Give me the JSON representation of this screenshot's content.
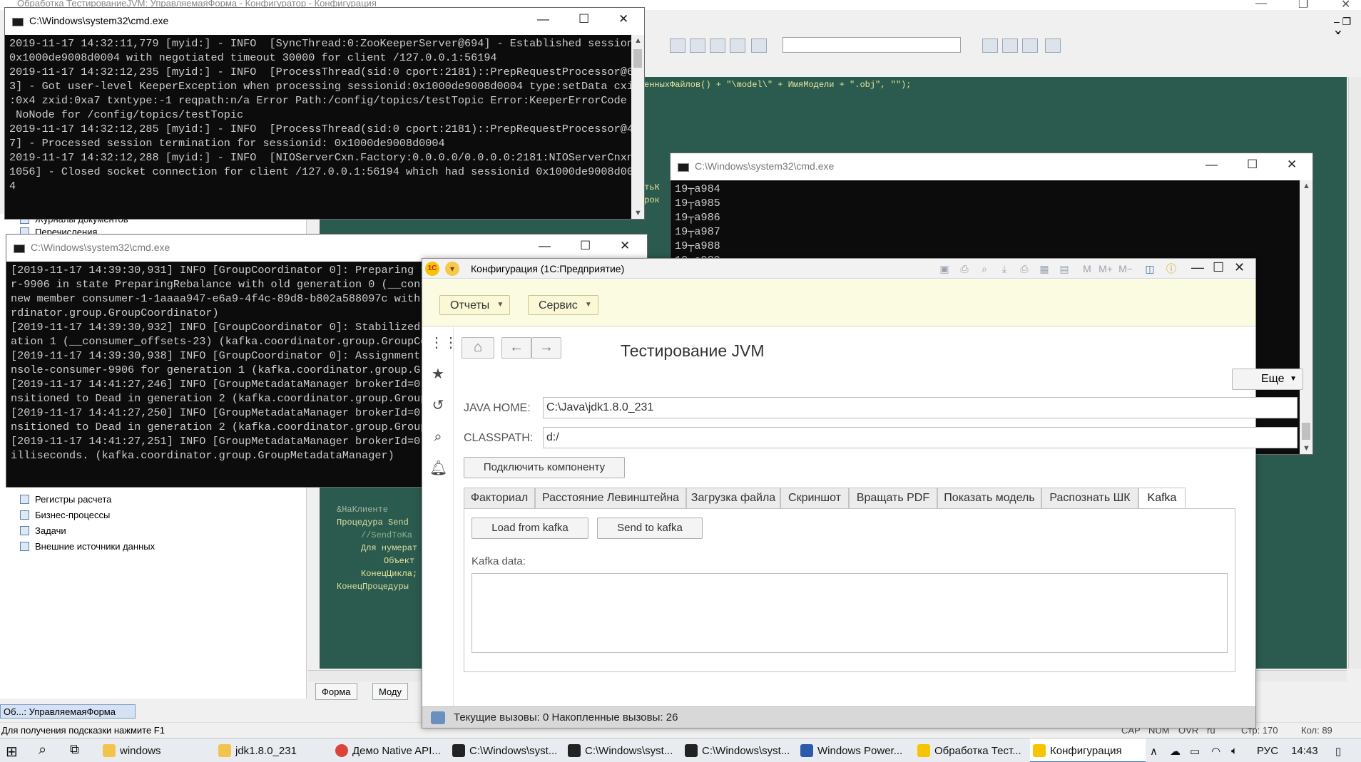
{
  "bg_window": {
    "title": "Обработка ТестированиеJVM: УправляемаяФорма - Конфигуратор - Конфигурация",
    "code_lines": [
      "енныхФайлов() + \"\\model\\\" + ИмяМодели + \".obj\", \"\");",
      "утьК",
      "трок",
      "&НаКлиенте",
      "Процедура Send",
      "//SendToKa",
      "Для нумерат",
      "Объект",
      "КонецЦикла;",
      "КонецПроцедуры"
    ],
    "tree_items": [
      "Журналы документов",
      "Перечисления",
      "Регистры расчета",
      "Бизнес-процессы",
      "Задачи",
      "Внешние источники данных"
    ],
    "bottom_tabs": [
      "Форма",
      "Моду"
    ],
    "window_list_item": "Об...: УправляемаяФорма",
    "status_hint": "Для получения подсказки нажмите F1",
    "status_right": [
      "CAP",
      "NUM",
      "OVR",
      "ru",
      "Стр: 170",
      "Кол: 89"
    ]
  },
  "cmd1": {
    "title": "C:\\Windows\\system32\\cmd.exe",
    "lines": [
      "2019-11-17 14:32:11,779 [myid:] - INFO  [SyncThread:0:ZooKeeperServer@694] - Established session",
      "0x1000de9008d0004 with negotiated timeout 30000 for client /127.0.0.1:56194",
      "2019-11-17 14:32:12,235 [myid:] - INFO  [ProcessThread(sid:0 cport:2181)::PrepRequestProcessor@65",
      "3] - Got user-level KeeperException when processing sessionid:0x1000de9008d0004 type:setData cxid",
      ":0x4 zxid:0xa7 txntype:-1 reqpath:n/a Error Path:/config/topics/testTopic Error:KeeperErrorCode =",
      " NoNode for /config/topics/testTopic",
      "2019-11-17 14:32:12,285 [myid:] - INFO  [ProcessThread(sid:0 cport:2181)::PrepRequestProcessor@48",
      "7] - Processed session termination for sessionid: 0x1000de9008d0004",
      "2019-11-17 14:32:12,288 [myid:] - INFO  [NIOServerCxn.Factory:0.0.0.0/0.0.0.0:2181:NIOServerCnxn@",
      "1056] - Closed socket connection for client /127.0.0.1:56194 which had sessionid 0x1000de9008d000",
      "4"
    ]
  },
  "cmd2": {
    "title": "C:\\Windows\\system32\\cmd.exe",
    "lines": [
      "[2019-11-17 14:39:30,931] INFO [GroupCoordinator 0]: Preparing to",
      "r-9906 in state PreparingRebalance with old generation 0 (__consu",
      "new member consumer-1-1aaaa947-e6a9-4f4c-89d8-b802a588097c with g",
      "rdinator.group.GroupCoordinator)",
      "[2019-11-17 14:39:30,932] INFO [GroupCoordinator 0]: Stabilized g",
      "ation 1 (__consumer_offsets-23) (kafka.coordinator.group.GroupCoo",
      "[2019-11-17 14:39:30,938] INFO [GroupCoordinator 0]: Assignment r",
      "nsole-consumer-9906 for generation 1 (kafka.coordinator.group.Gro",
      "[2019-11-17 14:41:27,246] INFO [GroupMetadataManager brokerId=0] ",
      "nsitioned to Dead in generation 2 (kafka.coordinator.group.GroupM",
      "[2019-11-17 14:41:27,250] INFO [GroupMetadataManager brokerId=0] ",
      "nsitioned to Dead in generation 2 (kafka.coordinator.group.GroupM",
      "[2019-11-17 14:41:27,251] INFO [GroupMetadataManager brokerId=0] ",
      "illiseconds. (kafka.coordinator.group.GroupMetadataManager)"
    ]
  },
  "cmd3": {
    "title": "C:\\Windows\\system32\\cmd.exe",
    "lines": [
      "19┬a984",
      "19┬a985",
      "19┬a986",
      "19┬a987",
      "19┬a988",
      "19┬a989"
    ]
  },
  "onec": {
    "title": "Конфигурация (1С:Предприятие)",
    "logo": "1С",
    "menu": [
      "Отчеты",
      "Сервис"
    ],
    "form_title": "Тестирование JVM",
    "more_label": "Еще",
    "java_home_label": "JAVA HOME:",
    "java_home_value": "C:\\Java\\jdk1.8.0_231",
    "classpath_label": "CLASSPATH:",
    "classpath_value": "d:/",
    "connect_button": "Подключить компоненту",
    "tabs": [
      "Факториал",
      "Расстояние Левинштейна",
      "Загрузка файла",
      "Скриншот",
      "Вращать PDF",
      "Показать модель",
      "Распознать ШК",
      "Kafka"
    ],
    "active_tab": "Kafka",
    "load_button": "Load from kafka",
    "send_button": "Send to kafka",
    "kafka_data_label": "Kafka data:",
    "kafka_data_value": "",
    "status_text": "Текущие вызовы: 0   Накопленные вызовы: 26"
  },
  "taskbar": {
    "items": [
      "windows",
      "jdk1.8.0_231",
      "Демо Native API...",
      "C:\\Windows\\syst...",
      "C:\\Windows\\syst...",
      "C:\\Windows\\syst...",
      "Windows Power...",
      "Обработка Тест...",
      "Конфигурация"
    ],
    "active_item": "Конфигурация",
    "lang": "РУС",
    "time": "14:43"
  },
  "colors": {
    "console_bg": "#0c0c0c",
    "console_text": "#cccccc",
    "code_bg": "#2b5a4e",
    "onec_command_bar": "#fbfbe1",
    "onec_status": "#d8d8d8"
  }
}
